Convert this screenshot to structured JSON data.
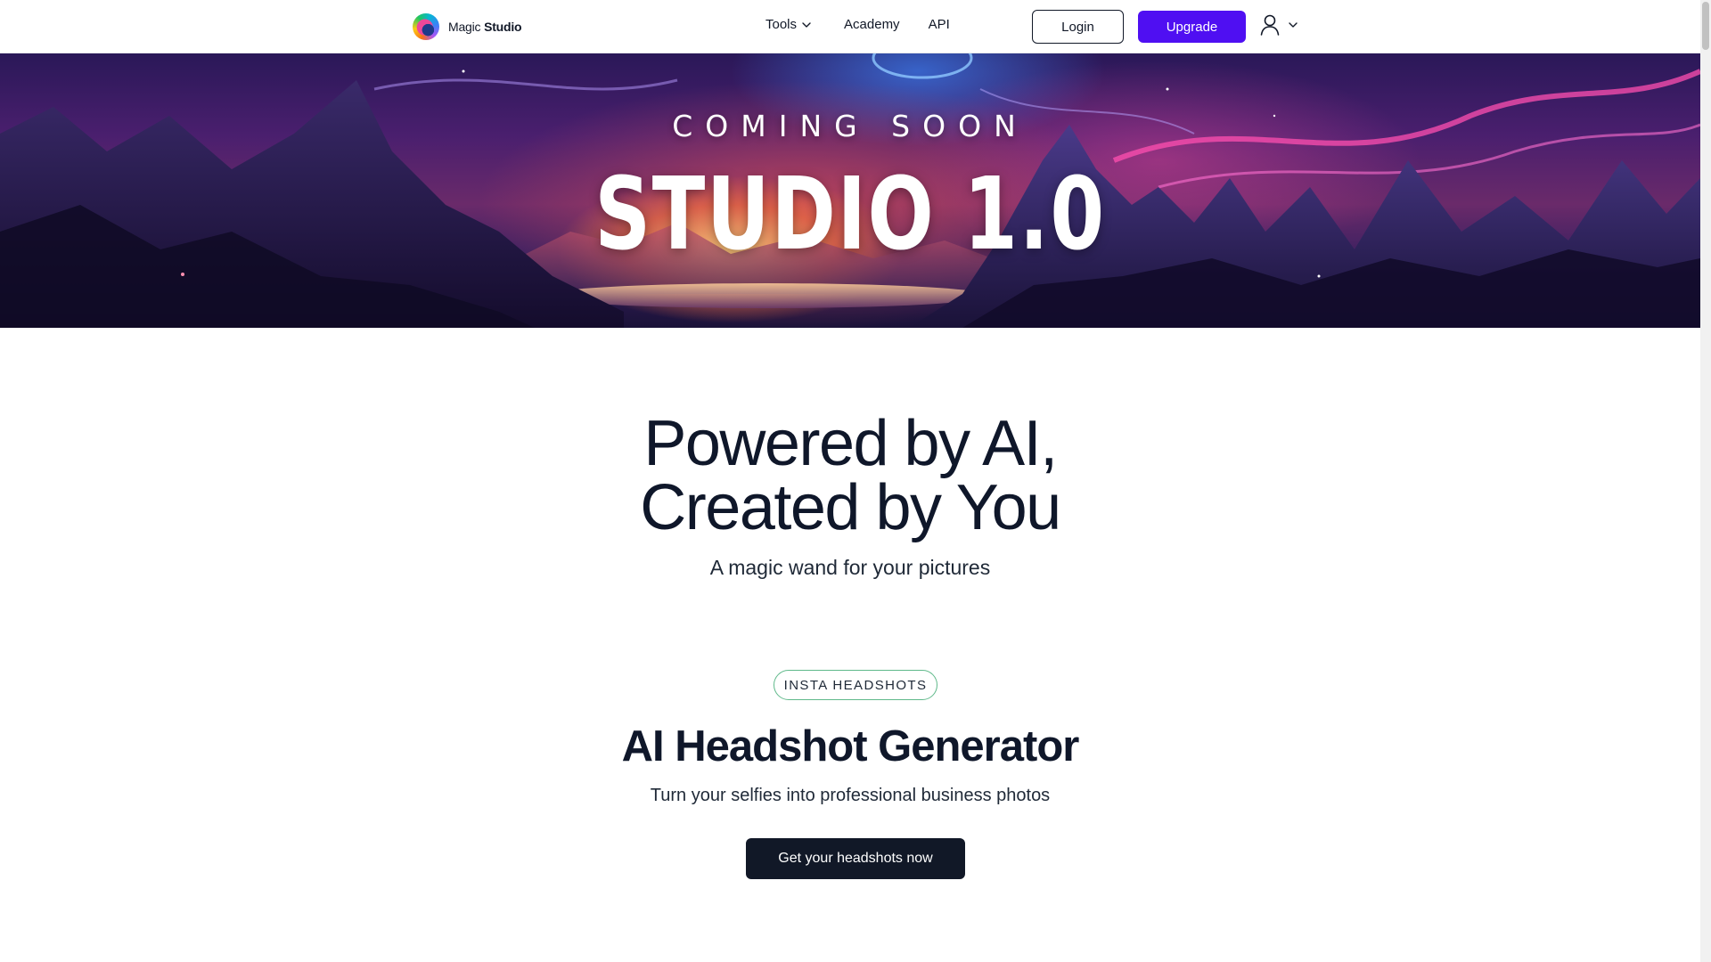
{
  "brand": {
    "name_light": "Magic",
    "name_bold": "Studio"
  },
  "nav": {
    "tools_label": "Tools",
    "academy_label": "Academy",
    "api_label": "API",
    "login_label": "Login",
    "upgrade_label": "Upgrade"
  },
  "hero": {
    "kicker": "COMING SOON",
    "title": "STUDIO 1.0"
  },
  "main": {
    "headline_line1": "Powered by AI,",
    "headline_line2": "Created by You",
    "subhead": "A magic wand for your pictures"
  },
  "feature": {
    "badge": "INSTA HEADSHOTS",
    "title": "AI Headshot Generator",
    "subtitle": "Turn your selfies into professional business photos",
    "cta_label": "Get your headshots now"
  },
  "colors": {
    "upgrade_bg": "#4f0ff2",
    "cta_bg": "#111827",
    "badge_border": "#5fb98a",
    "text_dark": "#0f172a"
  },
  "icons": [
    "logo-icon",
    "chevron-down-icon",
    "user-icon"
  ]
}
